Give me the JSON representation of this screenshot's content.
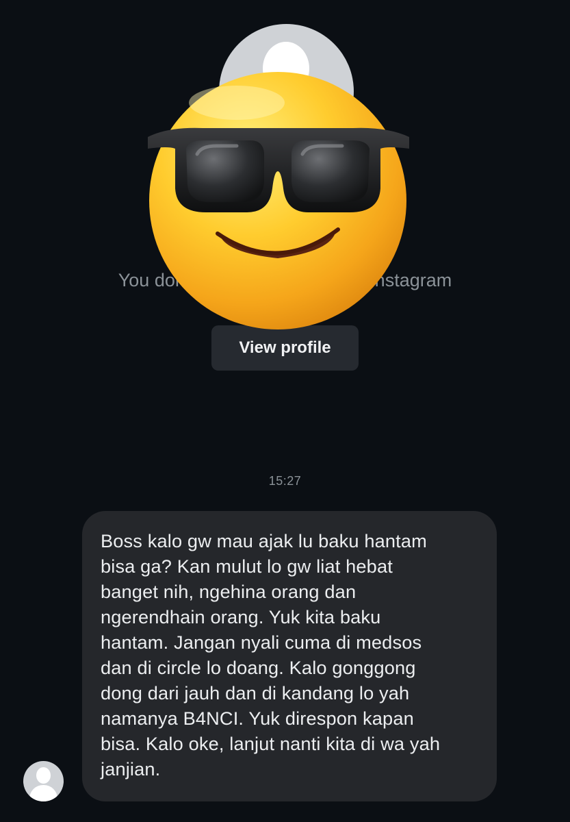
{
  "profile": {
    "subtitle": "You don't follow each other on Instagram",
    "view_profile_label": "View profile"
  },
  "overlay": {
    "emoji_icon": "smiling-face-with-sunglasses-icon"
  },
  "thread": {
    "timestamp": "15:27",
    "message_lines": [
      "Boss kalo gw mau ajak lu baku hantam",
      "bisa ga? Kan mulut lo gw liat hebat",
      "banget nih, ngehina orang dan",
      "ngerendhain orang. Yuk kita baku",
      "hantam. Jangan nyali cuma di medsos",
      "dan di circle lo doang. Kalo gonggong",
      "dong dari jauh dan di kandang lo yah",
      "namanya B4NCI. Yuk direspon kapan",
      "bisa. Kalo oke, lanjut nanti kita di wa yah",
      "janjian."
    ]
  },
  "colors": {
    "background": "#0b0f14",
    "bubble": "#25272b",
    "button": "#262a30",
    "muted_text": "#8b9298"
  }
}
